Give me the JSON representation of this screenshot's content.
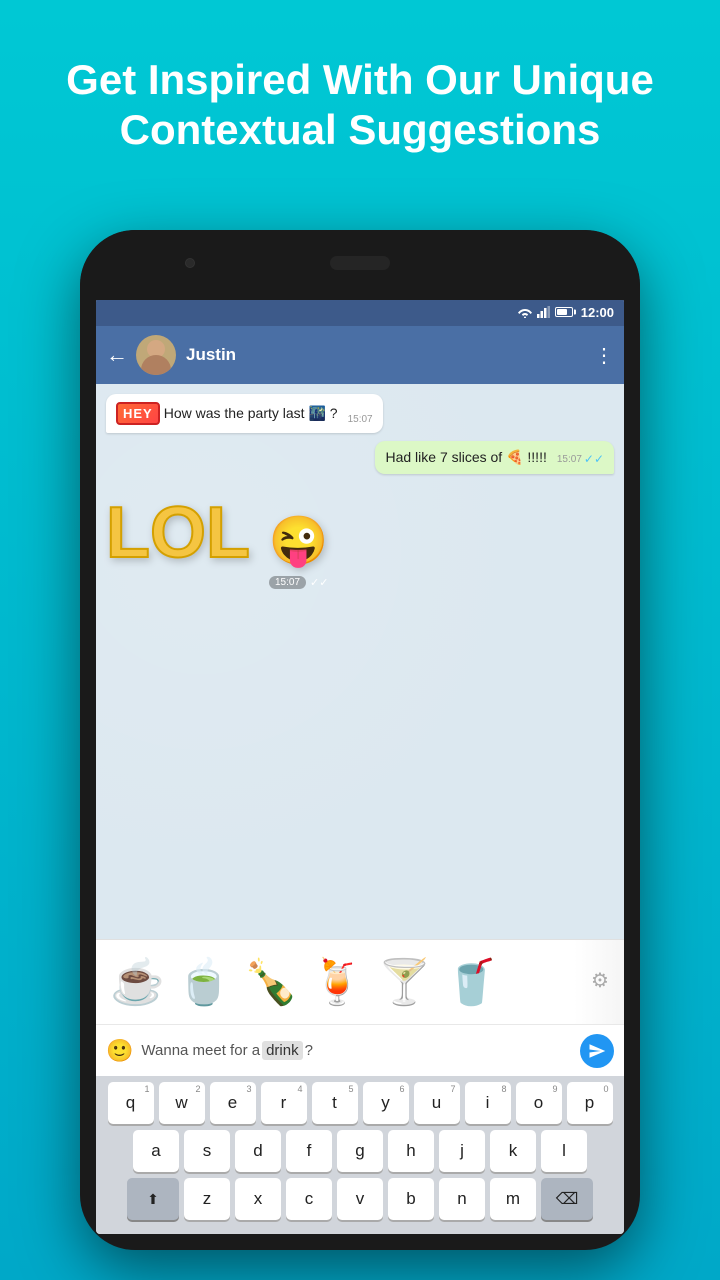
{
  "header": {
    "title": "Get Inspired With Our Unique Contextual Suggestions"
  },
  "phone": {
    "status_bar": {
      "time": "12:00"
    },
    "chat_header": {
      "contact": "Justin",
      "back_label": "←",
      "more_label": "⋮"
    },
    "messages": [
      {
        "type": "received",
        "prefix_sticker": "HEY",
        "text": "How was the party last",
        "emoji": "🌃",
        "suffix": "?",
        "time": "15:07"
      },
      {
        "type": "sent",
        "text": "Had like 7 slices of",
        "emoji": "🍕",
        "suffix": "!!!!!",
        "time": "15:07"
      },
      {
        "type": "received-sticker",
        "sticker": "😜",
        "lol_text": "LOL",
        "time": "15:07"
      }
    ],
    "suggestions": {
      "emojis": [
        "☕",
        "🍵",
        "🍾",
        "🍹",
        "🍸",
        "🥤"
      ]
    },
    "input": {
      "text_before": "Wanna meet for a",
      "highlighted_word": "drink",
      "text_after": "?",
      "emoji_btn": "🙂",
      "send_label": "➤"
    },
    "keyboard": {
      "rows": [
        {
          "keys": [
            {
              "label": "q",
              "num": "1"
            },
            {
              "label": "w",
              "num": "2"
            },
            {
              "label": "e",
              "num": "3"
            },
            {
              "label": "r",
              "num": "4"
            },
            {
              "label": "t",
              "num": "5"
            },
            {
              "label": "y",
              "num": "6"
            },
            {
              "label": "u",
              "num": "7"
            },
            {
              "label": "i",
              "num": "8"
            },
            {
              "label": "o",
              "num": "9"
            },
            {
              "label": "p",
              "num": "0"
            }
          ]
        },
        {
          "keys": [
            {
              "label": "a"
            },
            {
              "label": "s"
            },
            {
              "label": "d"
            },
            {
              "label": "f"
            },
            {
              "label": "g"
            },
            {
              "label": "h"
            },
            {
              "label": "j"
            },
            {
              "label": "k"
            },
            {
              "label": "l"
            }
          ]
        },
        {
          "keys": [
            {
              "label": "⬆",
              "special": true
            },
            {
              "label": "z"
            },
            {
              "label": "x"
            },
            {
              "label": "c"
            },
            {
              "label": "v"
            },
            {
              "label": "b"
            },
            {
              "label": "n"
            },
            {
              "label": "m"
            },
            {
              "label": "⌫",
              "special": true,
              "delete": true
            }
          ]
        }
      ]
    }
  }
}
